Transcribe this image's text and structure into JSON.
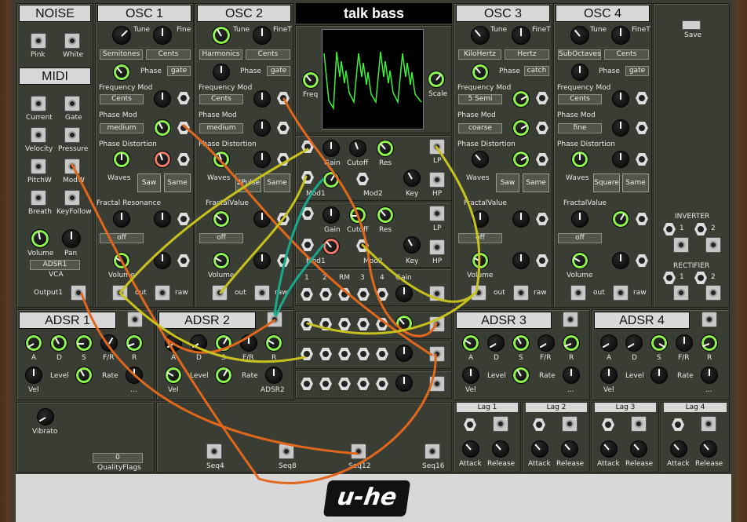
{
  "title": "talk bass",
  "noise": {
    "header": "NOISE",
    "pink": "Pink",
    "white": "White"
  },
  "midi": {
    "header": "MIDI",
    "outs": [
      "Current",
      "Gate",
      "Velocity",
      "Pressure",
      "PitchW",
      "ModW",
      "Breath",
      "KeyFollow"
    ],
    "volume": "Volume",
    "pan": "Pan",
    "vca_source": "ADSR1",
    "vca": "VCA",
    "output": "Output1"
  },
  "osc1": {
    "header": "OSC 1",
    "tune": "Tune",
    "fine": "Fine",
    "tune_mode": "Semitones",
    "fine_mode": "Cents",
    "phase": "Phase",
    "phase_mode": "gate",
    "freq_mod": "Frequency Mod",
    "freq_mod_mode": "Cents",
    "phase_mod": "Phase Mod",
    "phase_mod_mode": "medium",
    "phase_dist": "Phase Distortion",
    "waves": "Waves",
    "wave_a": "Saw",
    "wave_b": "Same",
    "extra": "Fractal Resonance",
    "extra_mode": "off",
    "volume": "Volume",
    "out": "out",
    "raw": "raw"
  },
  "osc2": {
    "header": "OSC 2",
    "tune": "Tune",
    "fine": "FineT",
    "tune_mode": "Harmonics",
    "fine_mode": "Cents",
    "phase": "Phase",
    "phase_mode": "gate",
    "freq_mod": "Frequency Mod",
    "freq_mod_mode": "Cents",
    "phase_mod": "Phase Mod",
    "phase_mod_mode": "medium",
    "phase_dist": "Phase Distortion",
    "waves": "Waves",
    "wave_a": "2Pulse",
    "wave_b": "Same",
    "extra": "FractalValue",
    "extra_mode": "off",
    "volume": "Volume",
    "out": "out",
    "raw": "raw"
  },
  "osc3": {
    "header": "OSC 3",
    "tune": "Tune",
    "fine": "FineT",
    "tune_mode": "KiloHertz",
    "fine_mode": "Hertz",
    "phase": "Phase",
    "phase_mode": "catch",
    "freq_mod": "Frequency Mod",
    "freq_mod_mode": "5 Semi",
    "phase_mod": "Phase Mod",
    "phase_mod_mode": "coarse",
    "phase_dist": "Phase Distortion",
    "waves": "Waves",
    "wave_a": "Saw",
    "wave_b": "Same",
    "extra": "FractalValue",
    "extra_mode": "off",
    "volume": "Volume",
    "out": "out",
    "raw": "raw"
  },
  "osc4": {
    "header": "OSC 4",
    "tune": "Tune",
    "fine": "FineT",
    "tune_mode": "SubOctaves",
    "fine_mode": "Cents",
    "phase": "Phase",
    "phase_mode": "gate",
    "freq_mod": "Frequency Mod",
    "freq_mod_mode": "Cents",
    "phase_mod": "Phase Mod",
    "phase_mod_mode": "fine",
    "phase_dist": "Phase Distortion",
    "waves": "Waves",
    "wave_a": "Square",
    "wave_b": "Same",
    "extra": "FractalValue",
    "extra_mode": "off",
    "volume": "Volume",
    "out": "out",
    "raw": "raw"
  },
  "scope": {
    "freq": "Freq",
    "scale": "Scale"
  },
  "filter1": {
    "gain": "Gain",
    "cutoff": "Cutoff",
    "res": "Res",
    "lp": "LP",
    "hp": "HP",
    "mod1": "Mod1",
    "mod2": "Mod2",
    "key": "Key"
  },
  "filter2": {
    "gain": "Gain",
    "cutoff": "Cutoff",
    "res": "Res",
    "lp": "LP",
    "hp": "HP",
    "mod1": "Mod1",
    "mod2": "Mod2",
    "key": "Key"
  },
  "mixer": {
    "labels": [
      "1",
      "2",
      "RM",
      "3",
      "4",
      "Gain"
    ]
  },
  "save": "Save",
  "inverter": {
    "header": "INVERTER",
    "a": "1",
    "b": "2"
  },
  "rectifier": {
    "header": "RECTIFIER",
    "a": "1",
    "b": "2"
  },
  "adsr": [
    {
      "header": "ADSR 1",
      "labels": [
        "A",
        "D",
        "S",
        "F/R",
        "R"
      ],
      "level": "Level",
      "rate": "Rate",
      "vel": "Vel",
      "dots": "..."
    },
    {
      "header": "ADSR 2",
      "labels": [
        "A",
        "D",
        "S",
        "F/R",
        "R"
      ],
      "level": "Level",
      "rate": "Rate",
      "vel": "Vel",
      "dots": "ADSR2"
    },
    {
      "header": "ADSR 3",
      "labels": [
        "A",
        "D",
        "S",
        "F/R",
        "R"
      ],
      "level": "Level",
      "rate": "Rate",
      "vel": "Vel",
      "dots": "..."
    },
    {
      "header": "ADSR 4",
      "labels": [
        "A",
        "D",
        "S",
        "F/R",
        "R"
      ],
      "level": "Level",
      "rate": "Rate",
      "vel": "Vel",
      "dots": "..."
    }
  ],
  "vibrato": "Vibrato",
  "quality_value": "0",
  "quality": "QualityFlags",
  "seq": [
    "Seq4",
    "Seq8",
    "Seq12",
    "Seq16"
  ],
  "lags": [
    {
      "header": "Lag 1",
      "attack": "Attack",
      "release": "Release"
    },
    {
      "header": "Lag 2",
      "attack": "Attack",
      "release": "Release"
    },
    {
      "header": "Lag 3",
      "attack": "Attack",
      "release": "Release"
    },
    {
      "header": "Lag 4",
      "attack": "Attack",
      "release": "Release"
    }
  ],
  "brand": "u-he",
  "colors": {
    "panel": "#3a3d33",
    "knob_accent": "#8df54e",
    "cord_orange": "#e0671c",
    "cord_yellow": "#c8c21e",
    "cord_teal": "#1aa98c"
  }
}
